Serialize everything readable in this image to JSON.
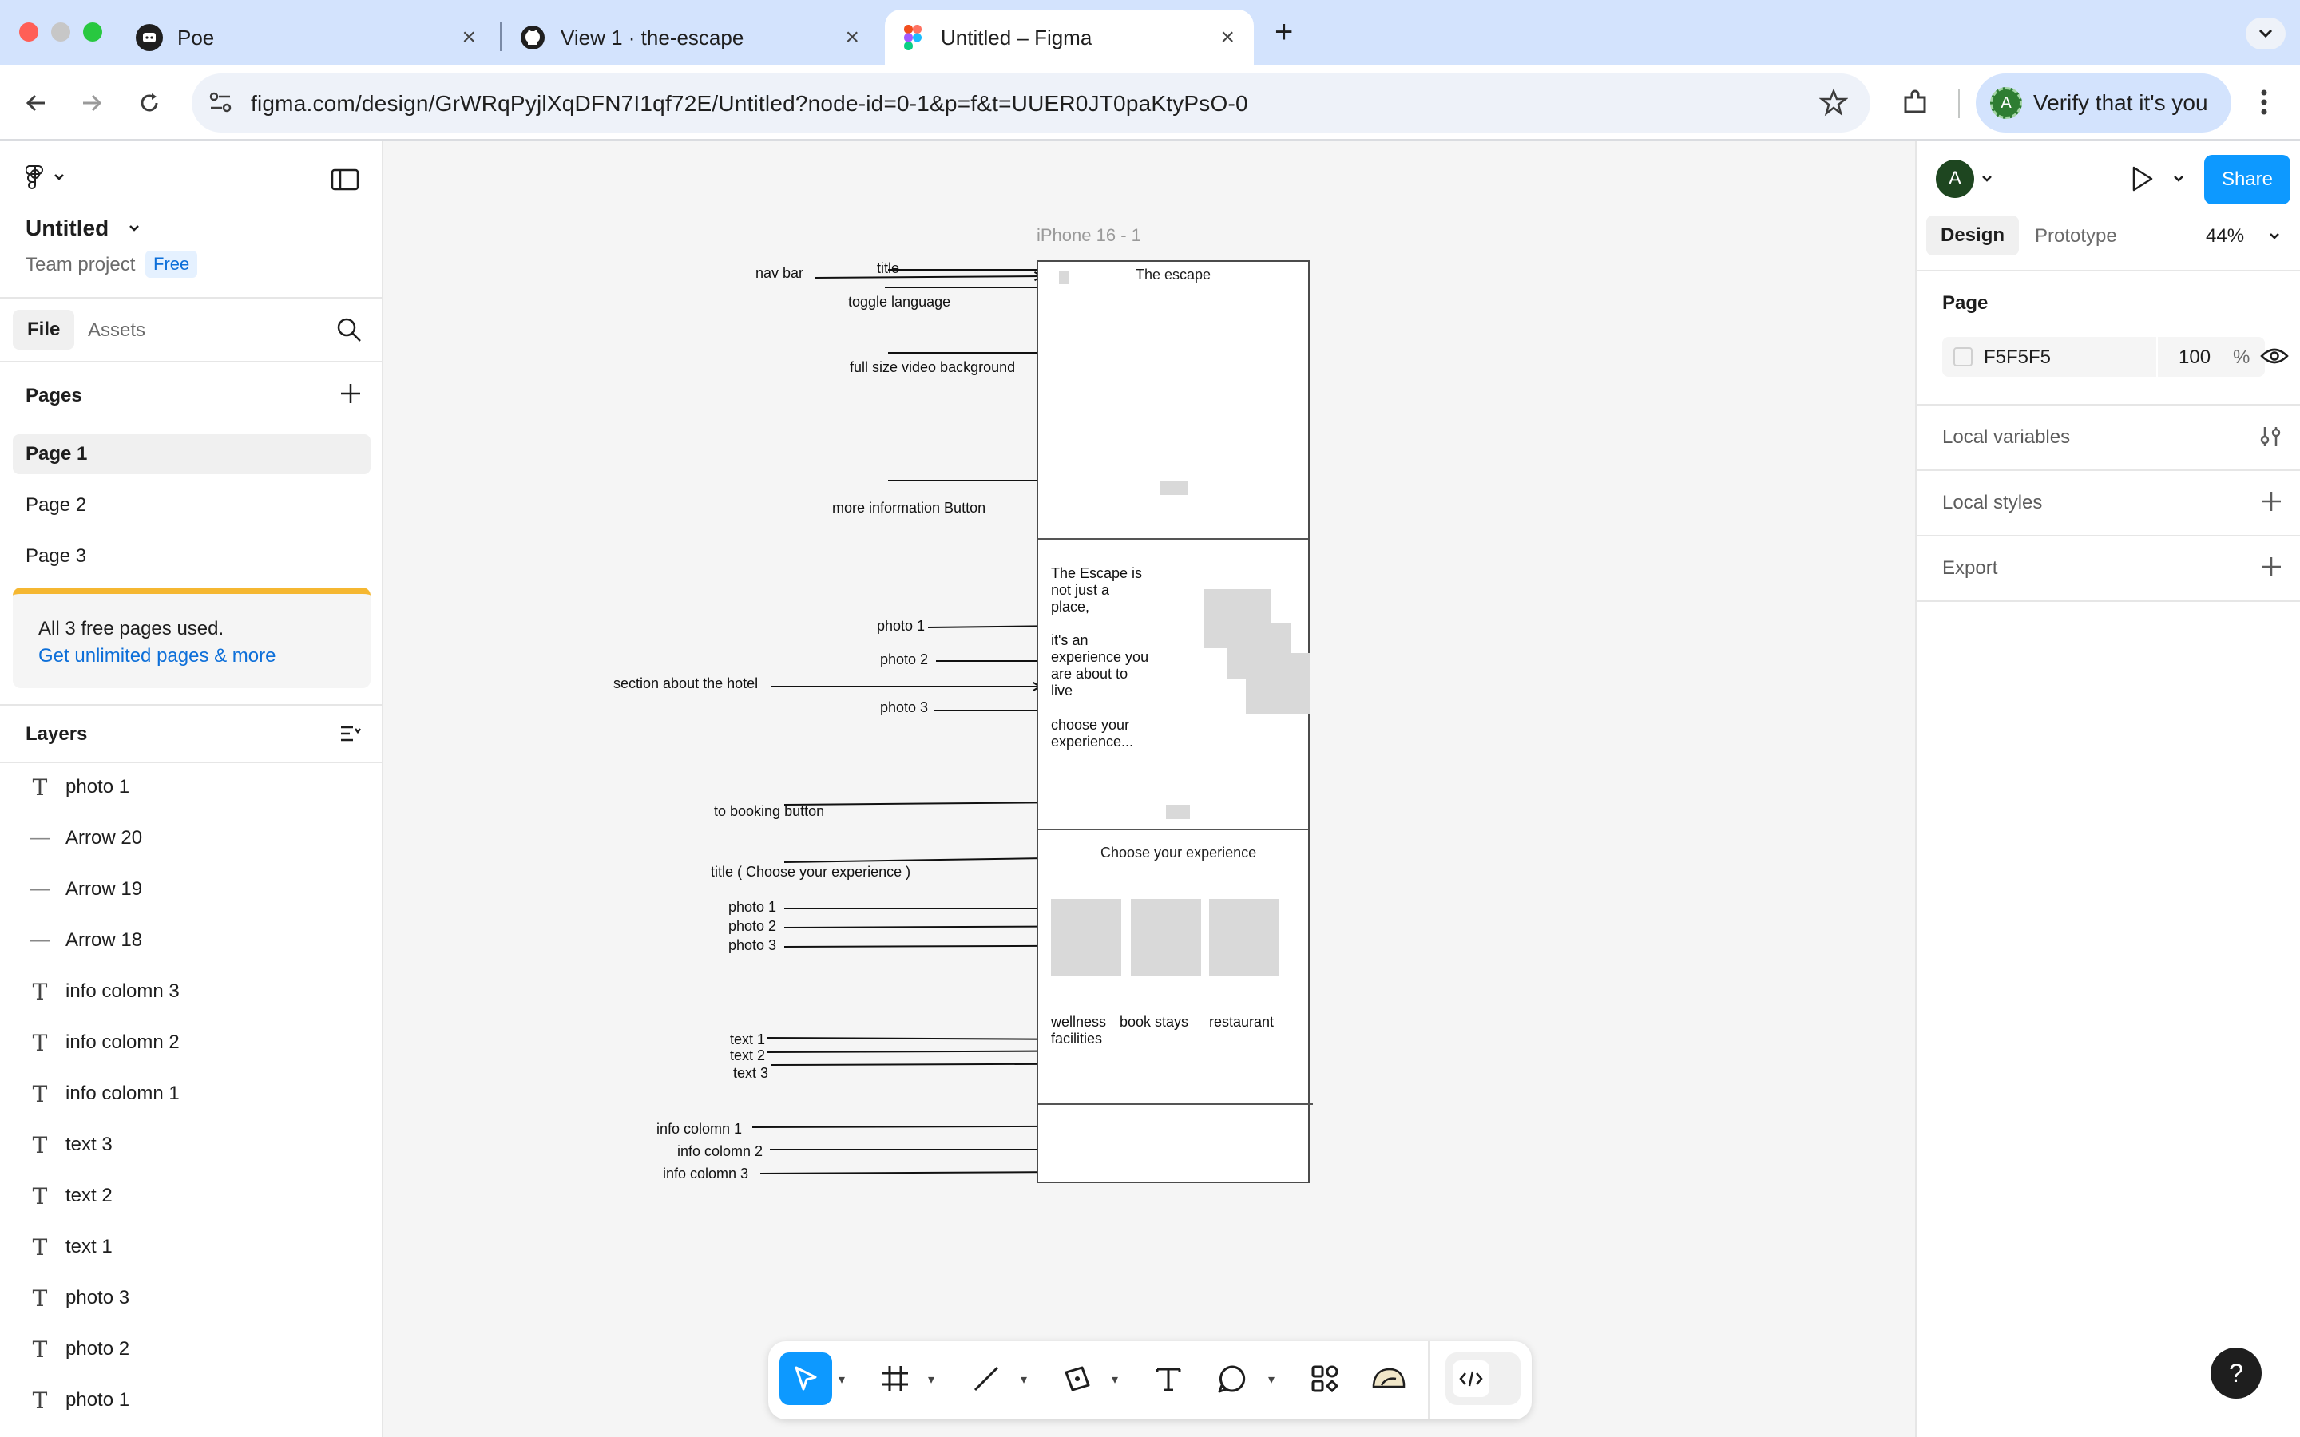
{
  "browser": {
    "tabs": [
      {
        "title": "Poe",
        "icon": "poe-icon"
      },
      {
        "title": "View 1 · the-escape",
        "icon": "github-icon"
      },
      {
        "title": "Untitled – Figma",
        "icon": "figma-icon",
        "active": true
      }
    ],
    "url": "figma.com/design/GrWRqPyjlXqDFN7I1qf72E/Untitled?node-id=0-1&p=f&t=UUER0JT0paKtyPsO-0",
    "verify_label": "Verify that it's you",
    "profile_initial": "A"
  },
  "left_panel": {
    "file_title": "Untitled",
    "team": "Team project",
    "plan_badge": "Free",
    "tabs": [
      "File",
      "Assets"
    ],
    "pages_heading": "Pages",
    "pages": [
      "Page 1",
      "Page 2",
      "Page 3"
    ],
    "notice_text": "All 3 free pages used.",
    "notice_link": "Get unlimited pages & more",
    "layers_heading": "Layers",
    "layers": [
      {
        "name": "photo 1",
        "kind": "text"
      },
      {
        "name": "Arrow 20",
        "kind": "line"
      },
      {
        "name": "Arrow 19",
        "kind": "line"
      },
      {
        "name": "Arrow 18",
        "kind": "line"
      },
      {
        "name": "info colomn 3",
        "kind": "text"
      },
      {
        "name": "info colomn 2",
        "kind": "text"
      },
      {
        "name": "info colomn 1",
        "kind": "text"
      },
      {
        "name": "text 3",
        "kind": "text"
      },
      {
        "name": "text 2",
        "kind": "text"
      },
      {
        "name": "text 1",
        "kind": "text"
      },
      {
        "name": "photo 3",
        "kind": "text"
      },
      {
        "name": "photo 2",
        "kind": "text"
      },
      {
        "name": "photo 1",
        "kind": "text"
      }
    ]
  },
  "right_panel": {
    "avatar_initial": "A",
    "share_label": "Share",
    "tabs": [
      "Design",
      "Prototype"
    ],
    "zoom": "44%",
    "page_heading": "Page",
    "page_color": "F5F5F5",
    "page_opacity": "100",
    "percent_sign": "%",
    "local_variables": "Local variables",
    "local_styles": "Local styles",
    "export": "Export",
    "help": "?"
  },
  "canvas": {
    "frame_label": "iPhone 16 - 1",
    "frame_title": "The escape",
    "about_text_1": "The Escape is not just a place,",
    "about_text_2": "it's an experience you are about to live",
    "about_text_3": "choose your experience...",
    "experience_title": "Choose your experience",
    "captions": [
      "wellness facilities",
      "book stays",
      "restaurant"
    ],
    "annotations": {
      "nav_bar": "nav bar",
      "title": "title",
      "toggle_language": "toggle language",
      "video_bg": "full size video background",
      "more_info": "more information Button",
      "photo_1": "photo 1",
      "photo_2": "photo 2",
      "section_about": "section about the hotel",
      "photo_3": "photo 3",
      "booking": "to booking button",
      "title_choose": "title ( Choose your experience )",
      "p1": "photo 1",
      "p2": "photo 2",
      "p3": "photo 3",
      "t1": "text 1",
      "t2": "text 2",
      "t3": "text 3",
      "i1": "info colomn 1",
      "i2": "info colomn 2",
      "i3": "info colomn 3"
    }
  }
}
